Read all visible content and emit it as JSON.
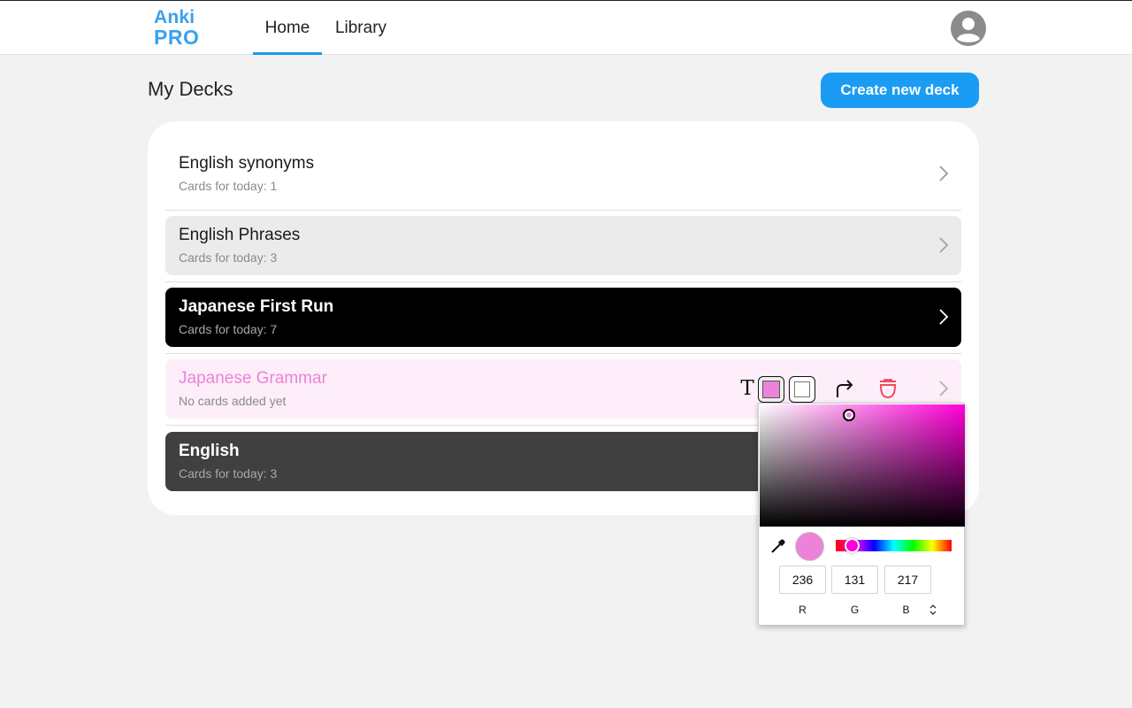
{
  "header": {
    "logo_line1": "Anki",
    "logo_line2": "PRO",
    "tabs": [
      {
        "label": "Home",
        "active": true
      },
      {
        "label": "Library",
        "active": false
      }
    ],
    "avatar_icon": "user-avatar-icon"
  },
  "main": {
    "title": "My Decks",
    "create_button": "Create new deck",
    "decks": [
      {
        "name": "English synonyms",
        "subtitle": "Cards for today: 1",
        "color": "#ffffff"
      },
      {
        "name": "English Phrases",
        "subtitle": "Cards for today: 3",
        "color": "#ebebeb"
      },
      {
        "name": "Japanese First Run",
        "subtitle": "Cards for today: 7",
        "color": "#000000"
      },
      {
        "name": "Japanese Grammar",
        "subtitle": "No cards added yet",
        "color": "#fdeefa",
        "text_color": "#ec83d9"
      },
      {
        "name": "English",
        "subtitle": "Cards for today: 3",
        "color": "#404040"
      }
    ]
  },
  "deck_toolbar": {
    "text_icon_glyph": "T",
    "icons": [
      "text-color-icon",
      "fill-color-icon",
      "background-color-icon",
      "share-icon",
      "delete-icon"
    ],
    "fill_color": "#ec83d9"
  },
  "color_picker": {
    "r": "236",
    "g": "131",
    "b": "217",
    "label_r": "R",
    "label_g": "G",
    "label_b": "B",
    "current_color": "#ec83d9",
    "hue_color": "#ff00d8"
  },
  "colors": {
    "accent": "#1a9cf5",
    "logo": "#3aa0ef",
    "delete": "#f0485a"
  }
}
